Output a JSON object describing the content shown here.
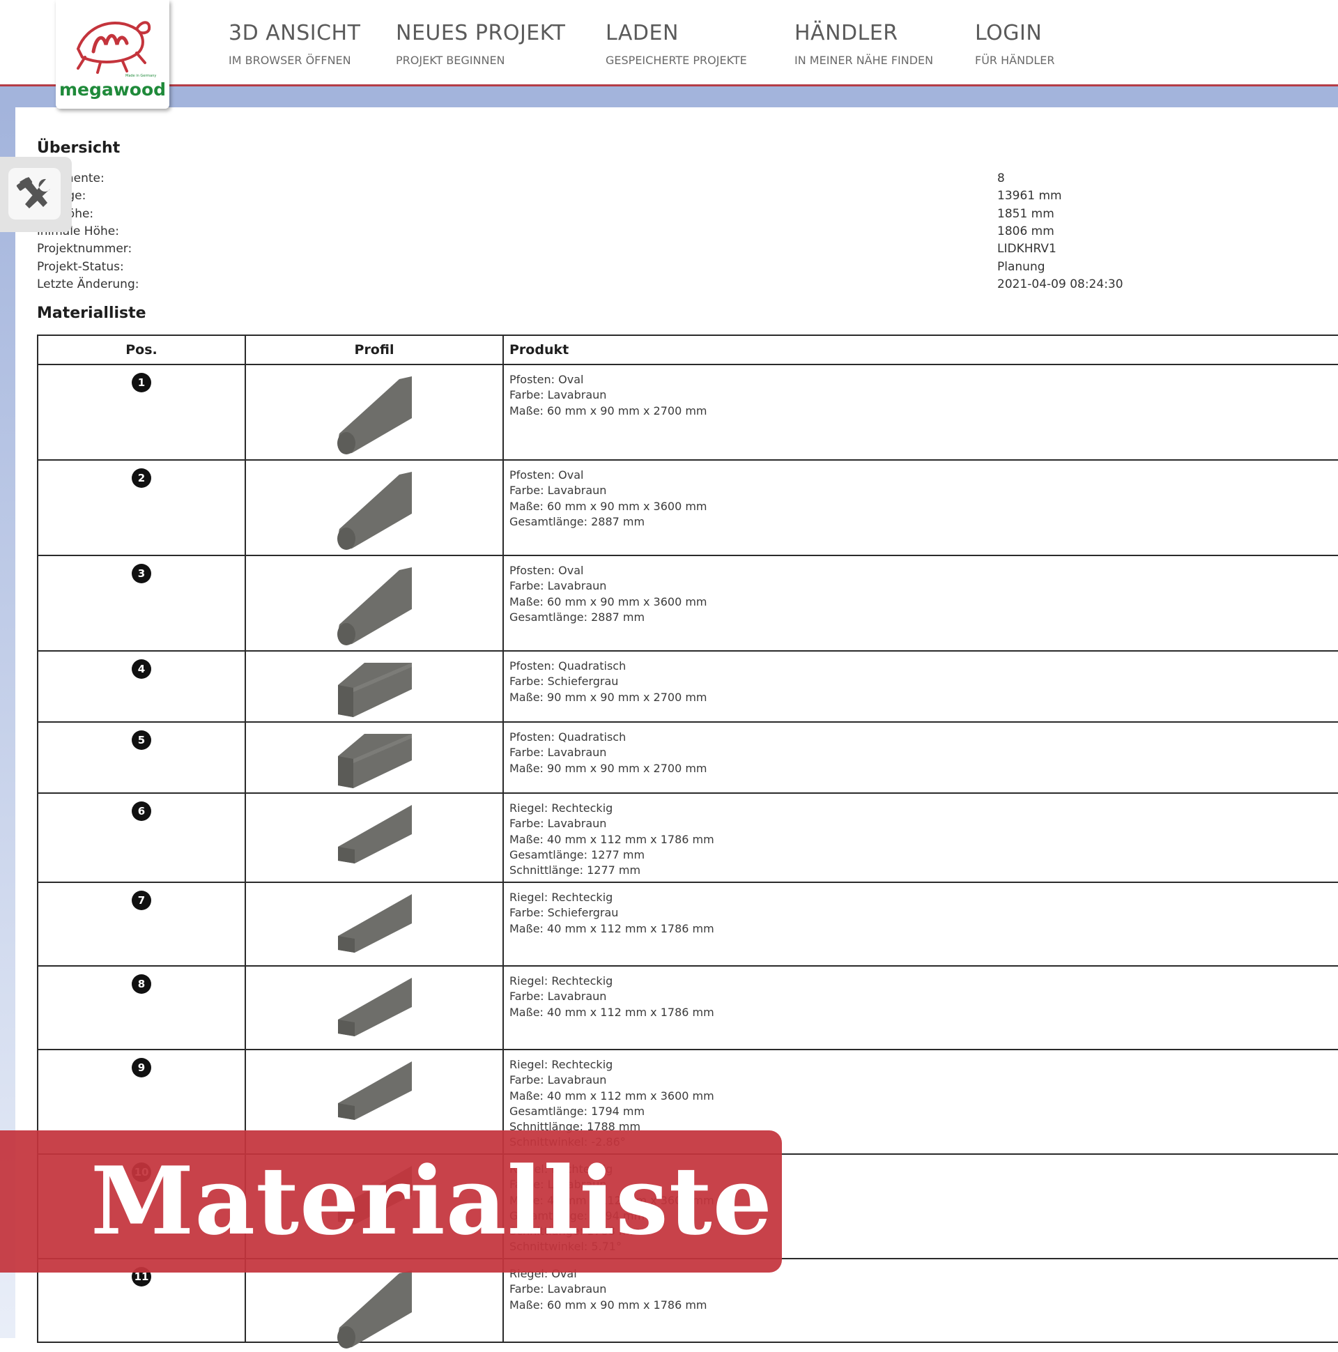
{
  "brand": {
    "name": "megawood",
    "tagline": "Made in Germany"
  },
  "nav": [
    {
      "title": "3D ANSICHT",
      "sub": "IM BROWSER ÖFFNEN"
    },
    {
      "title": "NEUES PROJEKT",
      "sub": "PROJEKT BEGINNEN"
    },
    {
      "title": "LADEN",
      "sub": "GESPEICHERTE PROJEKTE"
    },
    {
      "title": "HÄNDLER",
      "sub": "IN MEINER NÄHE FINDEN"
    },
    {
      "title": "LOGIN",
      "sub": "FÜR HÄNDLER"
    }
  ],
  "tools": {
    "icon": "hammer-wrench-icon"
  },
  "overview": {
    "heading": "Übersicht",
    "rows": [
      {
        "label": "l Elemente:",
        "value": "8"
      },
      {
        "label": "ntlänge:",
        "value": "13961 mm"
      },
      {
        "label": "ale Höhe:",
        "value": "1851 mm"
      },
      {
        "label": "inimale Höhe:",
        "value": "1806 mm"
      },
      {
        "label": "Projektnummer:",
        "value": "LIDKHRV1"
      },
      {
        "label": "Projekt-Status:",
        "value": "Planung"
      },
      {
        "label": "Letzte Änderung:",
        "value": "2021-04-09 08:24:30"
      }
    ]
  },
  "materials": {
    "heading": "Materialliste",
    "columns": {
      "pos": "Pos.",
      "profile": "Profil",
      "product": "Produkt"
    },
    "rows": [
      {
        "pos": "1",
        "profile": "oval",
        "lines": [
          "Pfosten: Oval",
          "Farbe: Lavabraun",
          "Maße: 60 mm x 90 mm x 2700 mm"
        ]
      },
      {
        "pos": "2",
        "profile": "oval",
        "lines": [
          "Pfosten: Oval",
          "Farbe: Lavabraun",
          "Maße: 60 mm x 90 mm x 3600 mm",
          "Gesamtlänge: 2887 mm"
        ]
      },
      {
        "pos": "3",
        "profile": "oval",
        "lines": [
          "Pfosten: Oval",
          "Farbe: Lavabraun",
          "Maße: 60 mm x 90 mm x 3600 mm",
          "Gesamtlänge: 2887 mm"
        ]
      },
      {
        "pos": "4",
        "profile": "square",
        "lines": [
          "Pfosten: Quadratisch",
          "Farbe: Schiefergrau",
          "Maße: 90 mm x 90 mm x 2700 mm"
        ]
      },
      {
        "pos": "5",
        "profile": "square",
        "lines": [
          "Pfosten: Quadratisch",
          "Farbe: Lavabraun",
          "Maße: 90 mm x 90 mm x 2700 mm"
        ]
      },
      {
        "pos": "6",
        "profile": "flat",
        "lines": [
          "Riegel: Rechteckig",
          "Farbe: Lavabraun",
          "Maße: 40 mm x 112 mm x 1786 mm",
          "Gesamtlänge: 1277 mm",
          "Schnittlänge: 1277 mm"
        ]
      },
      {
        "pos": "7",
        "profile": "flat",
        "lines": [
          "Riegel: Rechteckig",
          "Farbe: Schiefergrau",
          "Maße: 40 mm x 112 mm x 1786 mm"
        ]
      },
      {
        "pos": "8",
        "profile": "flat",
        "lines": [
          "Riegel: Rechteckig",
          "Farbe: Lavabraun",
          "Maße: 40 mm x 112 mm x 1786 mm"
        ]
      },
      {
        "pos": "9",
        "profile": "flat",
        "lines": [
          "Riegel: Rechteckig",
          "Farbe: Lavabraun",
          "Maße: 40 mm x 112 mm x 3600 mm",
          "Gesamtlänge: 1794 mm",
          "Schnittlänge: 1788 mm",
          "Schnittwinkel: -2.86°"
        ]
      },
      {
        "pos": "10",
        "profile": "flat",
        "lines": [
          "Riegel: Rechteckig",
          "Farbe: Lavabraun",
          "Maße: 40 mm x 112 mm x 3600 mm",
          "Gesamtlänge: 1794 mm",
          "Schnittlänge: 1788 mm",
          "Schnittwinkel: 5.71°"
        ]
      },
      {
        "pos": "11",
        "profile": "oval",
        "lines": [
          "Riegel: Oval",
          "Farbe: Lavabraun",
          "Maße: 60 mm x 90 mm x 1786 mm"
        ]
      }
    ]
  },
  "banner": {
    "text": "Materialliste"
  },
  "colors": {
    "accent": "#b43c46",
    "band": "#a3b4dc",
    "brand_green": "#1f8a3a",
    "banner": "#c4343c"
  }
}
